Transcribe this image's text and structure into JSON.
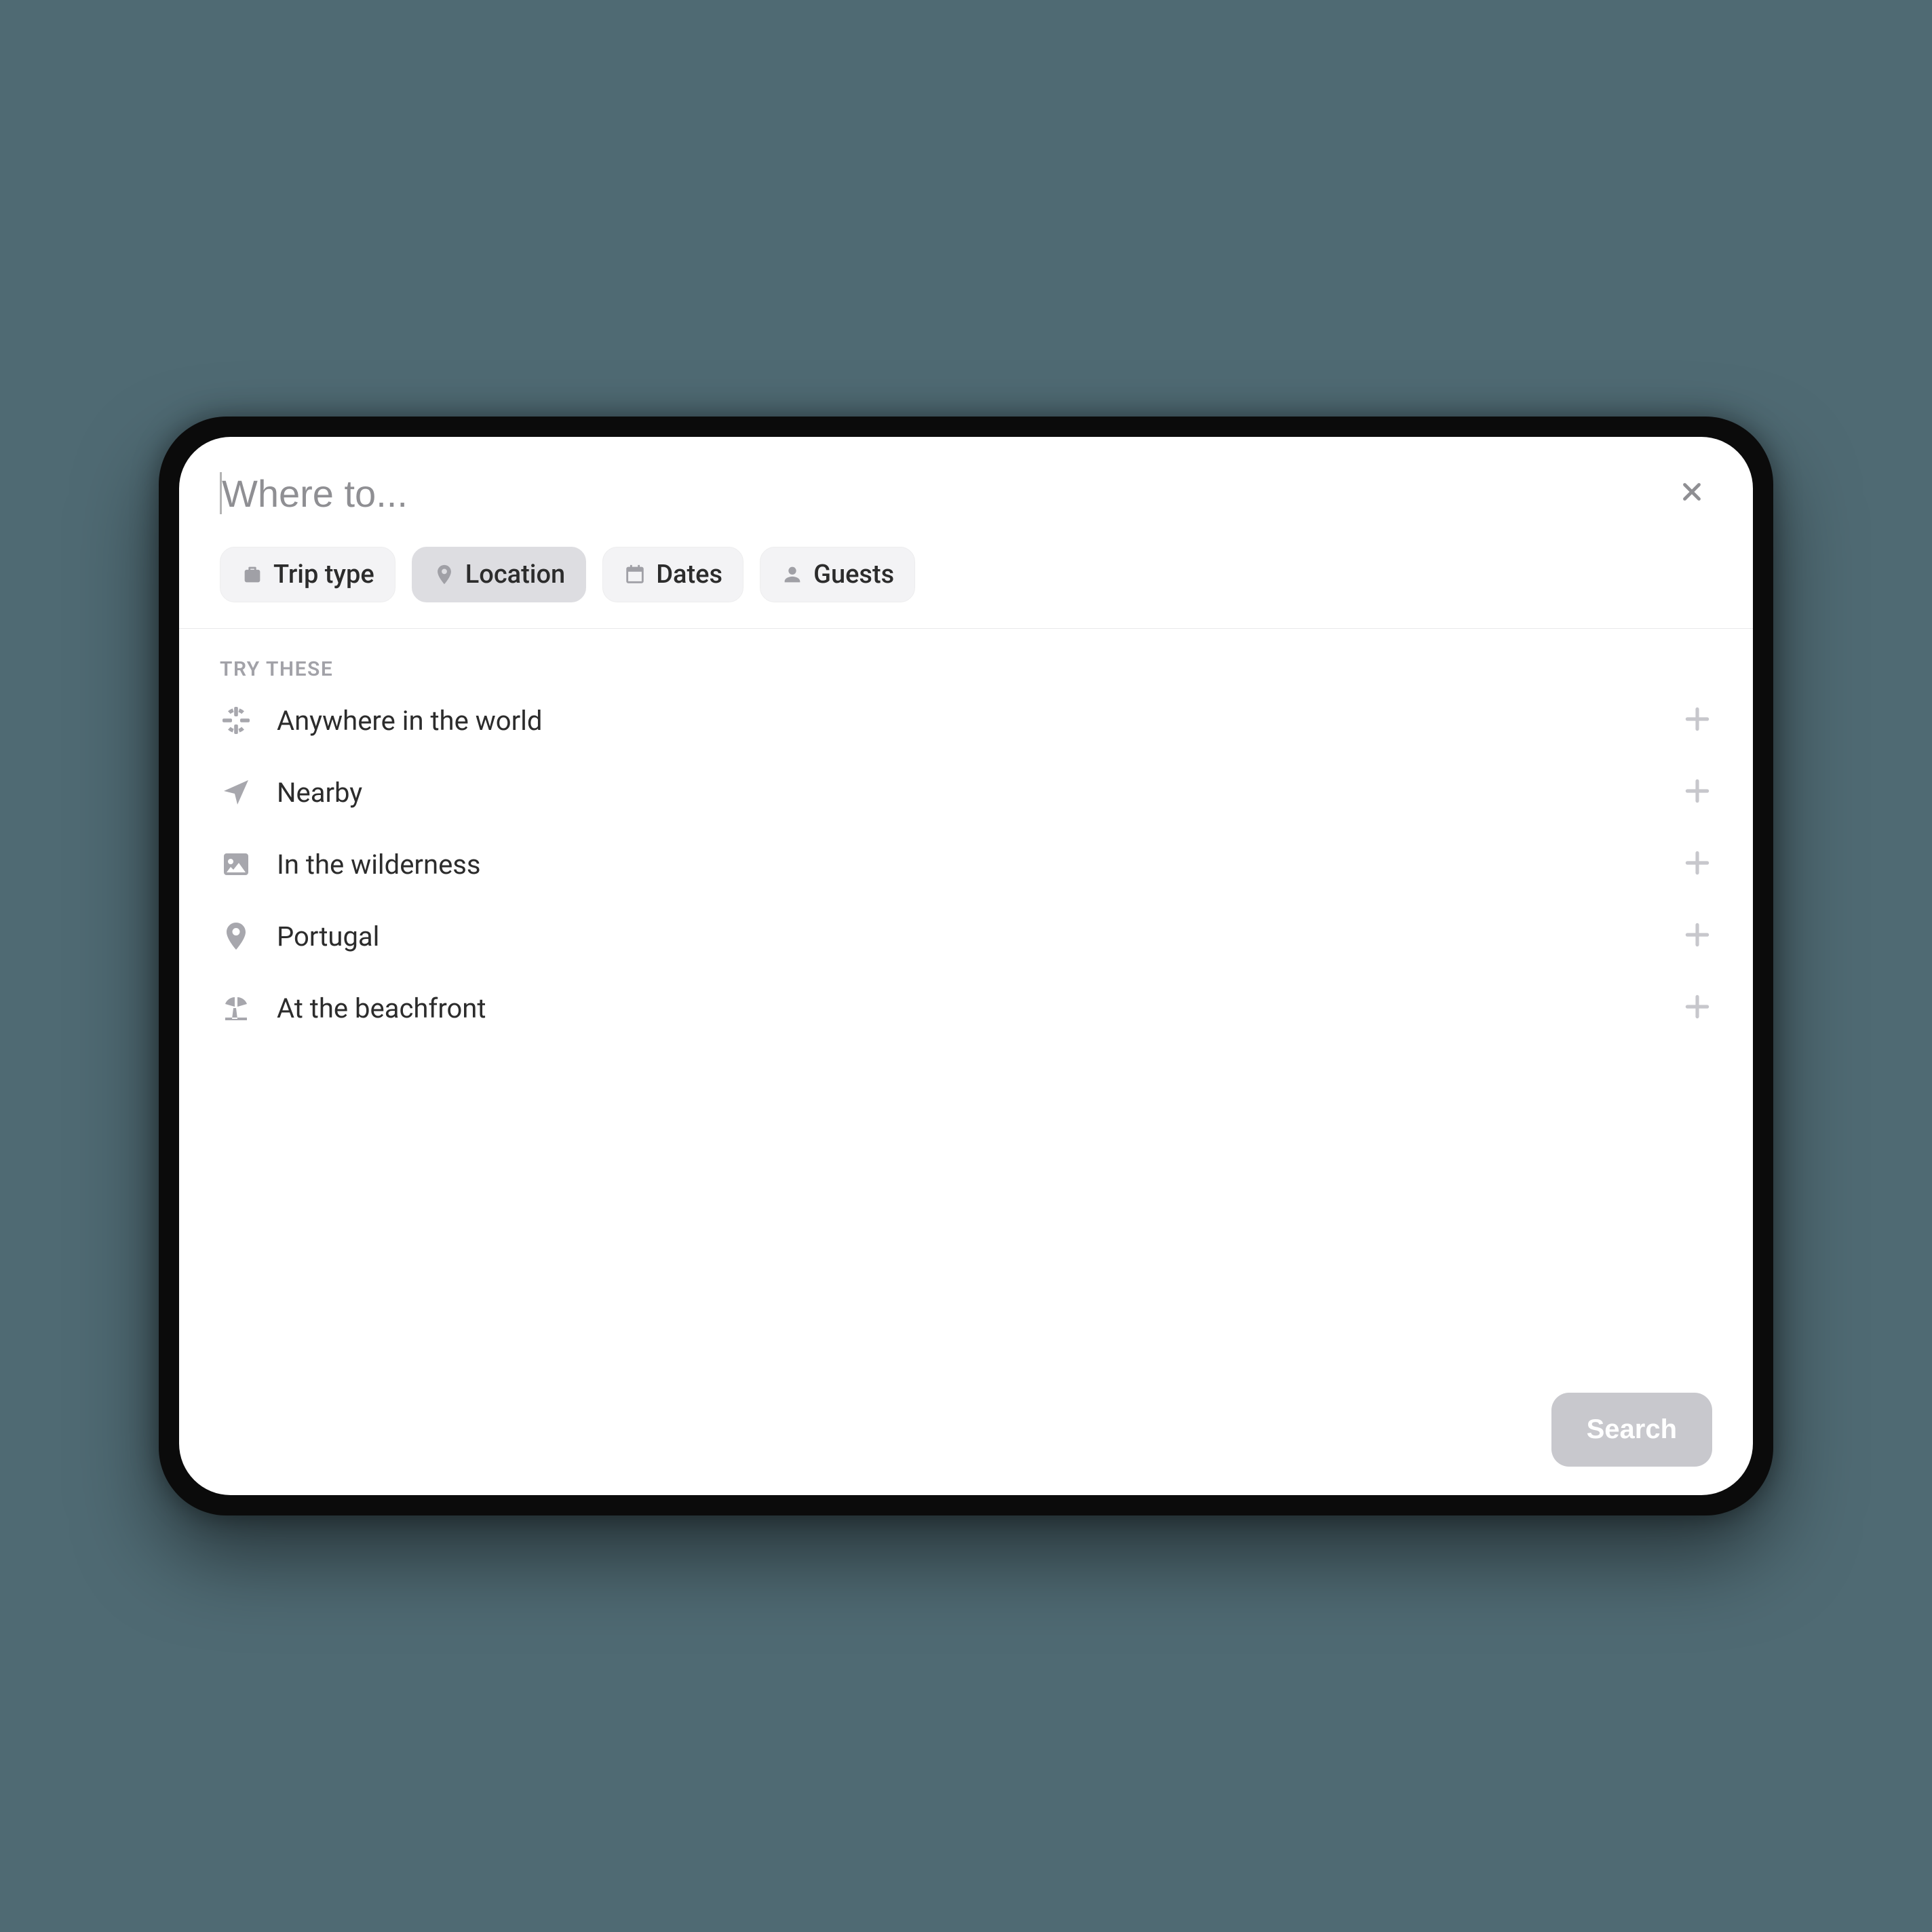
{
  "search": {
    "value": "",
    "placeholder": "Where to..."
  },
  "chips": {
    "trip_type": "Trip type",
    "location": "Location",
    "dates": "Dates",
    "guests": "Guests"
  },
  "section_title": "TRY THESE",
  "suggestions": [
    {
      "label": "Anywhere in the world"
    },
    {
      "label": "Nearby"
    },
    {
      "label": "In the wilderness"
    },
    {
      "label": "Portugal"
    },
    {
      "label": "At the beachfront"
    }
  ],
  "search_button": "Search"
}
